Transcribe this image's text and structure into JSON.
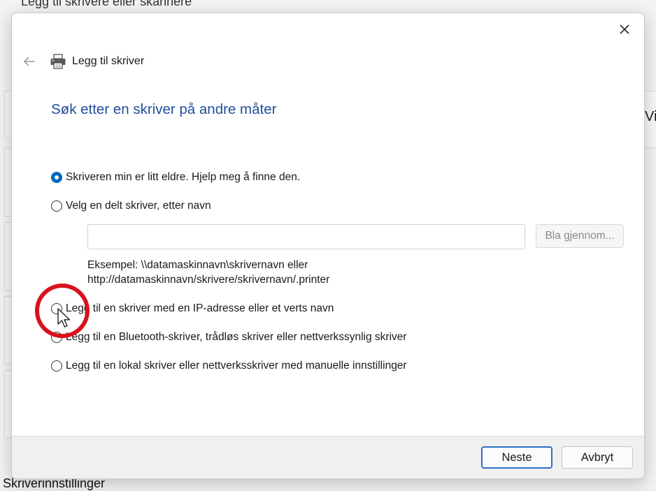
{
  "background": {
    "title": "Legg til skrivere eller skannere",
    "footer_text": "Skriverinnstillinger",
    "side_text": "Vi"
  },
  "dialog": {
    "header_title": "Legg til skriver",
    "heading": "Søk etter en skriver på andre måter",
    "options": [
      {
        "label": "Skriveren min er litt eldre. Hjelp meg å finne den.",
        "checked": true
      },
      {
        "label": "Velg en delt skriver, etter navn",
        "checked": false
      },
      {
        "label": "Legg til en skriver med en IP-adresse eller et verts navn",
        "checked": false
      },
      {
        "label": "Legg til en Bluetooth-skriver, trådløs skriver eller nettverkssynlig skriver",
        "checked": false
      },
      {
        "label": "Legg til en lokal skriver eller nettverksskriver med manuelle innstillinger",
        "checked": false
      }
    ],
    "shared_printer": {
      "input_value": "",
      "browse_label": "Bla gjennom...",
      "example_line1": "Eksempel: \\\\datamaskinnavn\\skrivernavn eller",
      "example_line2": "http://datamaskinnavn/skrivere/skrivernavn/.printer"
    },
    "buttons": {
      "next_label": "Neste",
      "cancel_label": "Avbryt"
    }
  },
  "icons": {
    "close": "close-icon",
    "back": "back-arrow-icon",
    "printer": "printer-icon",
    "cursor": "mouse-pointer-icon"
  },
  "colors": {
    "accent": "#0067c0",
    "heading": "#1f4e9c",
    "annotation": "#d8121d"
  }
}
